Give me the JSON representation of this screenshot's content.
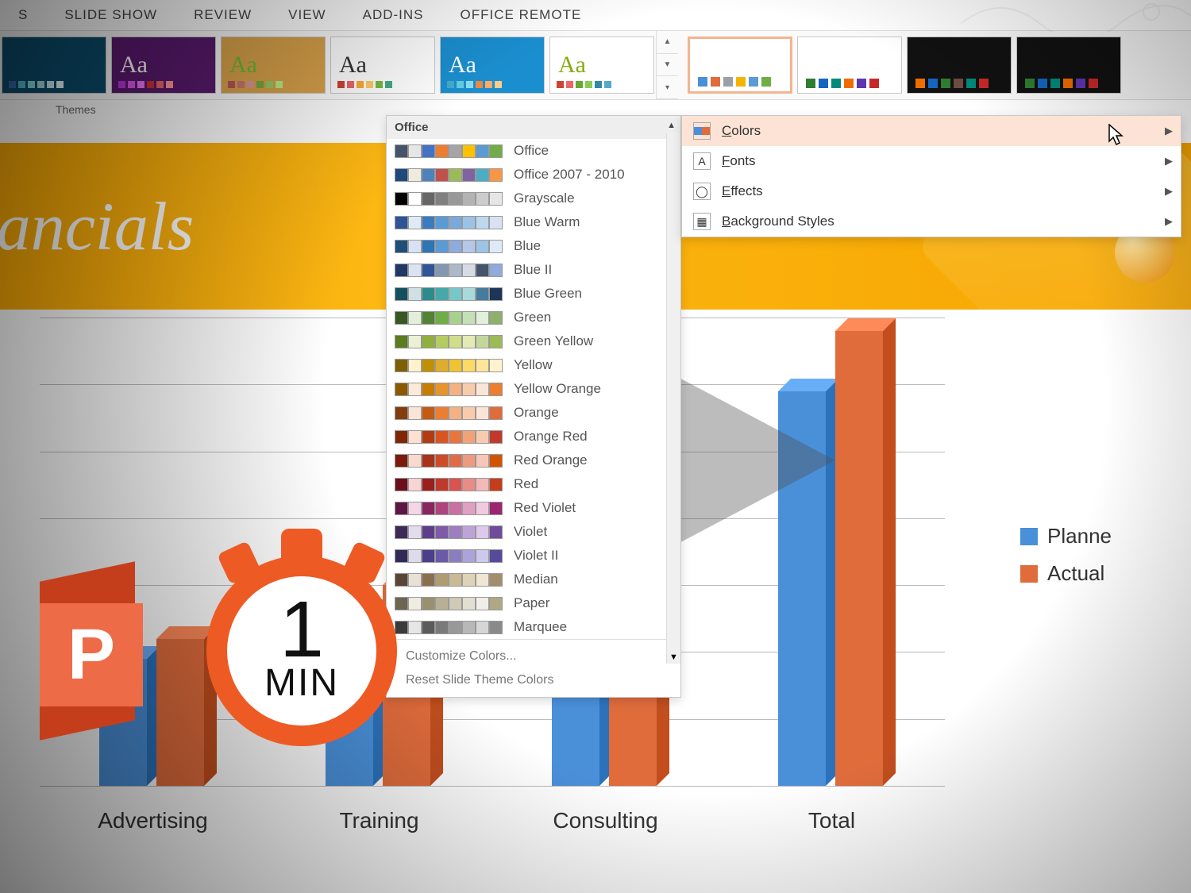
{
  "ribbon_tabs": [
    "S",
    "SLIDE SHOW",
    "REVIEW",
    "VIEW",
    "ADD-INS",
    "OFFICE REMOTE"
  ],
  "themes_label": "Themes",
  "theme_thumbs": [
    {
      "bg": "#0b4c6c",
      "fg": "#fff",
      "dots": [
        "#36a",
        "#5bc",
        "#8dd",
        "#add",
        "#cef",
        "#eff"
      ]
    },
    {
      "bg": "#5a1a6e",
      "fg": "#fff",
      "dots": [
        "#b3d",
        "#d5e",
        "#e7f",
        "#c33",
        "#e66",
        "#f99"
      ],
      "label": "Aa"
    },
    {
      "bg": "#d9a24a",
      "fg": "#6b3",
      "dots": [
        "#b55",
        "#c77",
        "#d99",
        "#7a4",
        "#9c6",
        "#be8"
      ],
      "label": "Aa"
    },
    {
      "bg": "#ffffff",
      "fg": "#333",
      "dots": [
        "#c43",
        "#e66",
        "#fa3",
        "#fc6",
        "#7b4",
        "#4a8"
      ],
      "label": "Aa"
    },
    {
      "bg": "#1b8ecf",
      "fg": "#fff",
      "dots": [
        "#4ac",
        "#6cd",
        "#8de",
        "#e84",
        "#fa6",
        "#fc8"
      ],
      "label": "Aa"
    },
    {
      "bg": "#ffffff",
      "fg": "#8a1",
      "dots": [
        "#c43",
        "#e66",
        "#6a3",
        "#8c5",
        "#38a",
        "#5ac"
      ],
      "label": "Aa"
    }
  ],
  "variant_thumbs": [
    {
      "dark": false,
      "sel": true,
      "dots": [
        "#4a90d9",
        "#e06c3c",
        "#9aa0a6",
        "#f4b400",
        "#5b9bd5",
        "#70ad47"
      ]
    },
    {
      "dark": false,
      "sel": false,
      "dots": [
        "#2e7d32",
        "#1565c0",
        "#00897b",
        "#ef6c00",
        "#5e35b1",
        "#c62828"
      ]
    },
    {
      "dark": true,
      "sel": false,
      "dots": [
        "#ef6c00",
        "#1565c0",
        "#2e7d32",
        "#6d4c41",
        "#00897b",
        "#c62828"
      ]
    },
    {
      "dark": true,
      "sel": false,
      "dots": [
        "#2e7d32",
        "#1565c0",
        "#00897b",
        "#ef6c00",
        "#5e35b1",
        "#c62828"
      ]
    }
  ],
  "variant_menu": [
    {
      "key": "colors",
      "label": "Colors",
      "hl": true
    },
    {
      "key": "fonts",
      "label": "Fonts",
      "hl": false
    },
    {
      "key": "effects",
      "label": "Effects",
      "hl": false
    },
    {
      "key": "bg",
      "label": "Background Styles",
      "hl": false
    }
  ],
  "colors_header": "Office",
  "color_schemes": [
    {
      "name": "Office",
      "c": [
        "#44546a",
        "#e7e6e6",
        "#4472c4",
        "#ed7d31",
        "#a5a5a5",
        "#ffc000",
        "#5b9bd5",
        "#70ad47"
      ]
    },
    {
      "name": "Office 2007 - 2010",
      "c": [
        "#1f497d",
        "#eeece1",
        "#4f81bd",
        "#c0504d",
        "#9bbb59",
        "#8064a2",
        "#4bacc6",
        "#f79646"
      ]
    },
    {
      "name": "Grayscale",
      "c": [
        "#000000",
        "#ffffff",
        "#666666",
        "#808080",
        "#999999",
        "#b3b3b3",
        "#cccccc",
        "#e6e6e6"
      ]
    },
    {
      "name": "Blue Warm",
      "c": [
        "#2f5496",
        "#deeaf6",
        "#3b7cc1",
        "#5b9bd5",
        "#7ba9db",
        "#9cc2e5",
        "#bdd7ee",
        "#d9e2f3"
      ]
    },
    {
      "name": "Blue",
      "c": [
        "#1f4e79",
        "#d9e2f3",
        "#2e75b6",
        "#5b9bd5",
        "#8faadc",
        "#b4c7e7",
        "#9dc3e6",
        "#deebf7"
      ]
    },
    {
      "name": "Blue II",
      "c": [
        "#203864",
        "#dae3f3",
        "#2f5597",
        "#8497b0",
        "#adb9ca",
        "#d6dce5",
        "#44546a",
        "#8faadc"
      ]
    },
    {
      "name": "Blue Green",
      "c": [
        "#134f5c",
        "#d0e0e3",
        "#2e8b8b",
        "#45a9a9",
        "#76c7c7",
        "#a8dadc",
        "#457b9d",
        "#1d3557"
      ]
    },
    {
      "name": "Green",
      "c": [
        "#385723",
        "#e2f0d9",
        "#548235",
        "#70ad47",
        "#a9d18e",
        "#c5e0b4",
        "#e2efda",
        "#8faf6c"
      ]
    },
    {
      "name": "Green Yellow",
      "c": [
        "#5b7c1f",
        "#eaf1d5",
        "#8faf3f",
        "#b5cc62",
        "#d0de8a",
        "#e3eab3",
        "#c4d79b",
        "#9bbb59"
      ]
    },
    {
      "name": "Yellow",
      "c": [
        "#7f6000",
        "#fff2cc",
        "#bf9000",
        "#e0ac2b",
        "#f1c232",
        "#ffd966",
        "#ffe599",
        "#fff2cc"
      ]
    },
    {
      "name": "Yellow Orange",
      "c": [
        "#8b5a00",
        "#fde9d9",
        "#c77c00",
        "#e6952e",
        "#f4b183",
        "#f8cbad",
        "#fbe5d6",
        "#ed7d31"
      ]
    },
    {
      "name": "Orange",
      "c": [
        "#843c0c",
        "#fbe5d6",
        "#c55a11",
        "#ed7d31",
        "#f4b183",
        "#f8cbad",
        "#fbe5d6",
        "#e06c3c"
      ]
    },
    {
      "name": "Orange Red",
      "c": [
        "#7f2704",
        "#fde0d0",
        "#b33b12",
        "#d9541e",
        "#e9743e",
        "#f2a277",
        "#f8cbb0",
        "#c0392b"
      ]
    },
    {
      "name": "Red Orange",
      "c": [
        "#7a1b0c",
        "#fcd9cf",
        "#a8321a",
        "#cf4a28",
        "#e06c47",
        "#ee9a7e",
        "#f7c6b6",
        "#d35400"
      ]
    },
    {
      "name": "Red",
      "c": [
        "#6b0f1a",
        "#f8d4d4",
        "#9a1f1f",
        "#c0392b",
        "#d9534f",
        "#e98b87",
        "#f3b9b7",
        "#c43e1c"
      ]
    },
    {
      "name": "Red Violet",
      "c": [
        "#5e1742",
        "#f4d6e6",
        "#8a2560",
        "#b0447f",
        "#cc6fa1",
        "#e19fc2",
        "#f0cbdf",
        "#9b256f"
      ]
    },
    {
      "name": "Violet",
      "c": [
        "#3e2a56",
        "#e4dced",
        "#5e3e8a",
        "#7e5aa8",
        "#9e7ec1",
        "#bea3d9",
        "#ddc9ec",
        "#704b9b"
      ]
    },
    {
      "name": "Violet II",
      "c": [
        "#2f2a56",
        "#dedceb",
        "#4b3e8a",
        "#6a5aa8",
        "#8a7ec1",
        "#aba3d9",
        "#ccc9ec",
        "#564b9b"
      ]
    },
    {
      "name": "Median",
      "c": [
        "#5b4636",
        "#e9e0d4",
        "#8a6f4f",
        "#b09b72",
        "#c9b994",
        "#dfd3b7",
        "#efe6d4",
        "#a38e6a"
      ]
    },
    {
      "name": "Paper",
      "c": [
        "#6e6550",
        "#efece1",
        "#999070",
        "#b8b095",
        "#cfc9b5",
        "#e2ded0",
        "#f0eee6",
        "#b0a884"
      ]
    },
    {
      "name": "Marquee",
      "c": [
        "#3b3b3b",
        "#e6e6e6",
        "#5b5b5b",
        "#7a7a7a",
        "#999999",
        "#b8b8b8",
        "#d6d6d6",
        "#8a8a8a"
      ]
    }
  ],
  "colors_footer": {
    "customize": "Customize Colors...",
    "reset": "Reset Slide Theme Colors"
  },
  "slide": {
    "title": "r financials"
  },
  "chart_data": {
    "type": "bar",
    "categories": [
      "Advertising",
      "Training",
      "Consulting",
      "Total"
    ],
    "series": [
      {
        "name": "Planned",
        "color": "#4a90d9",
        "values": [
          190,
          260,
          140,
          590
        ]
      },
      {
        "name": "Actual",
        "color": "#e06c3c",
        "values": [
          220,
          300,
          160,
          680
        ]
      }
    ],
    "ylabel": "",
    "xlabel": "",
    "ylim": [
      0,
      700
    ],
    "y_ticks_visible_suffix": "0",
    "grid": true,
    "three_d": true
  },
  "legend": [
    {
      "label": "Planne",
      "color": "#4a90d9"
    },
    {
      "label": "Actual",
      "color": "#e06c3c"
    }
  ],
  "badge": {
    "letter": "P",
    "big": "1",
    "unit": "MIN"
  }
}
